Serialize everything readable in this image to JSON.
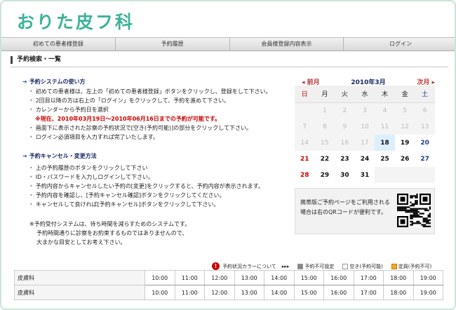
{
  "logo": "おりた皮フ科",
  "nav": [
    "初めての患者様登録",
    "予約履歴",
    "会員様登録内容表示",
    "ログイン"
  ],
  "page_title": "予約検索・一覧",
  "usage": {
    "heading": "予約システムの使い方",
    "items": [
      "初めての患者様は、左上の「初めての患者様登録」ボタンをクリックし、登録をして下さい。",
      "2回目以降の方は右上の「ログイン」をクリックして、予約を進めて下さい。",
      "カレンダーから予約日を選択",
      "※現在、2010年03月19日～2010年06月16日までの予約が可能です。",
      "画面下に表示された診察の予約状況で[空き(予約可能)]の部分をクリックして下さい。",
      "ログイン必須項目を入力すれば完了いたします。"
    ]
  },
  "cancel": {
    "heading": "予約キャンセル・変更方法",
    "items": [
      "上の予約履歴のボタンをクリックして下さい",
      "ID・パスワードを入力しログインして下さい。",
      "予約内容からキャンセルしたい予約の[変更]をクリックすると、予約内容が表示されます。",
      "予約内容を確認し、[予約キャンセル確認]ボタンをクリックしてください。",
      "キャンセルして良ければ[予約キャンセル]ボタンをクリックして下さい。"
    ]
  },
  "note": [
    "※予約受付システムは、待ち時間を減らすためのシステムです。",
    "予約時間通りに診察をお約束するものではありませんので、",
    "大まかな目安としてお考え下さい。"
  ],
  "calendar": {
    "prev": "前月",
    "month": "2010年3月",
    "next": "次月",
    "weekdays": [
      "日",
      "月",
      "火",
      "水",
      "木",
      "金",
      "土"
    ],
    "weeks": [
      [
        "",
        "1",
        "2",
        "3",
        "4",
        "5",
        "6"
      ],
      [
        "7",
        "8",
        "9",
        "10",
        "11",
        "12",
        "13"
      ],
      [
        "14",
        "15",
        "16",
        "17",
        "18",
        "19",
        "20"
      ],
      [
        "21",
        "22",
        "23",
        "24",
        "25",
        "26",
        "27"
      ],
      [
        "28",
        "29",
        "30",
        "31",
        "",
        "",
        ""
      ]
    ],
    "first_active_day": 18,
    "today": 18
  },
  "qr": {
    "lines": [
      "携帯版ご予約ページをご利用される",
      "場合は右のQRコードが便利です。"
    ]
  },
  "legend": {
    "title": "予約状況カラーについて",
    "arrow": "▸▸▸",
    "items": [
      "予約不可設定",
      "空き(予約可能)",
      "定員(予約不可)"
    ]
  },
  "slots": {
    "rows": [
      "皮膚科",
      "皮膚科"
    ],
    "times": [
      "10:00",
      "11:00",
      "12:00",
      "13:00",
      "14:00",
      "15:00",
      "16:00",
      "17:00",
      "18:00",
      "19:00"
    ]
  },
  "colors": {
    "logo": "#3db39a",
    "sunday": "#cc0000",
    "saturday": "#1f3a8a",
    "today_bg": "#dcefff",
    "full": "#f5a623"
  }
}
